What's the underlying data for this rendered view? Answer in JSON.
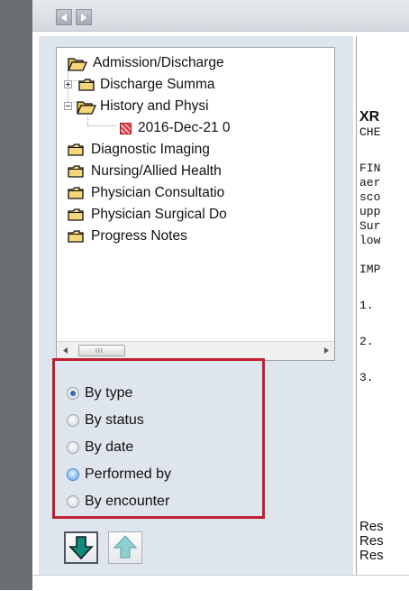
{
  "tree": {
    "nodes": [
      {
        "label": "Admission/Discharge",
        "state": "open"
      },
      {
        "label": "Discharge Summa",
        "state": "collapsed"
      },
      {
        "label": "History and Physi",
        "state": "expanded"
      },
      {
        "label": "2016-Dec-21 0",
        "type": "document"
      },
      {
        "label": "Diagnostic Imaging"
      },
      {
        "label": "Nursing/Allied Health"
      },
      {
        "label": "Physician Consultatio"
      },
      {
        "label": "Physician Surgical Do"
      },
      {
        "label": "Progress Notes"
      }
    ],
    "scrollbar_grip": "III"
  },
  "filters": {
    "options": [
      {
        "label": "By type",
        "selected": true
      },
      {
        "label": "By status",
        "selected": false
      },
      {
        "label": "By date",
        "selected": false
      },
      {
        "label": "Performed by",
        "selected": false,
        "hover": true
      },
      {
        "label": "By encounter",
        "selected": false
      }
    ]
  },
  "buttons": {
    "move_down_icon": "arrow-down",
    "move_up_icon": "arrow-up"
  },
  "report": {
    "lines": [
      "XR",
      "CHE",
      "FIN",
      "aer",
      "sco",
      "upp",
      "Sur",
      "low",
      "IMP",
      "1.",
      "2.",
      "3.",
      "Res",
      "Res",
      "Res"
    ]
  },
  "colors": {
    "highlight_box": "#c01f2f",
    "down_arrow": "#138a7a",
    "up_arrow": "#8fcfd2",
    "radio_selected": "#2f6fb8",
    "panel_bg": "#dfe5ec"
  }
}
